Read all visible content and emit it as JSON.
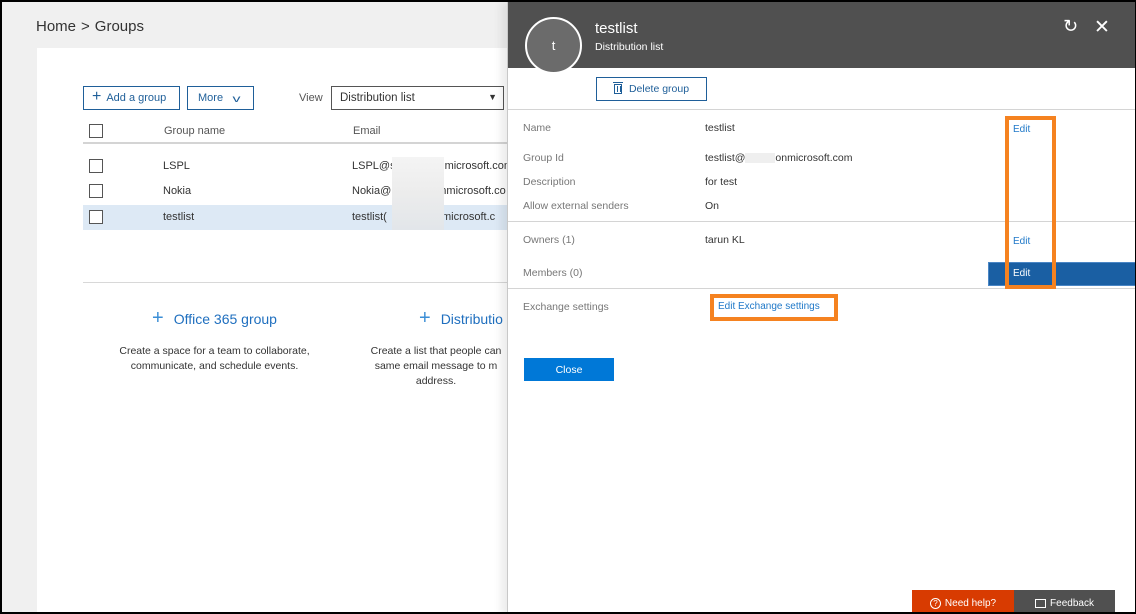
{
  "breadcrumb": {
    "items": [
      "Home",
      "Groups"
    ],
    "separator": ">"
  },
  "toolbar": {
    "add_group_label": "Add a group",
    "more_label": "More",
    "view_label": "View",
    "view_selected": "Distribution list"
  },
  "table": {
    "columns": [
      "Group name",
      "Email"
    ],
    "rows": [
      {
        "name": "LSPL",
        "email_start": "LSPL@s",
        "email_end": "microsoft.com",
        "selected": false
      },
      {
        "name": "Nokia",
        "email_start": "Nokia@",
        "email_end": "nmicrosoft.co",
        "selected": false
      },
      {
        "name": "testlist",
        "email_start": "testlist(",
        "email_end": "nmicrosoft.c",
        "selected": true
      }
    ]
  },
  "create_options": [
    {
      "title": "Office 365 group",
      "description": "Create a space for a team to collaborate, communicate, and schedule events."
    },
    {
      "title": "Distributio",
      "description": "Create a list that people can same email message to m address."
    }
  ],
  "panel": {
    "avatar_initial": "t",
    "title": "testlist",
    "subtitle": "Distribution list",
    "delete_label": "Delete group",
    "fields": [
      {
        "label": "Name",
        "value": "testlist",
        "action": "Edit"
      },
      {
        "label": "Group Id",
        "value_start": "testlist@",
        "value_end": "onmicrosoft.com"
      },
      {
        "label": "Description",
        "value": "for test"
      },
      {
        "label": "Allow external senders",
        "value": "On"
      },
      {
        "label": "Owners (1)",
        "value": "tarun KL",
        "action": "Edit"
      },
      {
        "label": "Members (0)",
        "value": "",
        "action": "Edit"
      },
      {
        "label": "Exchange settings",
        "link": "Edit Exchange settings"
      }
    ],
    "close_label": "Close"
  },
  "footer": {
    "need_help": "Need help?",
    "feedback": "Feedback"
  },
  "colors": {
    "accent": "#0078d7",
    "highlight": "#f58220",
    "header": "#505050",
    "help": "#d83b01"
  }
}
